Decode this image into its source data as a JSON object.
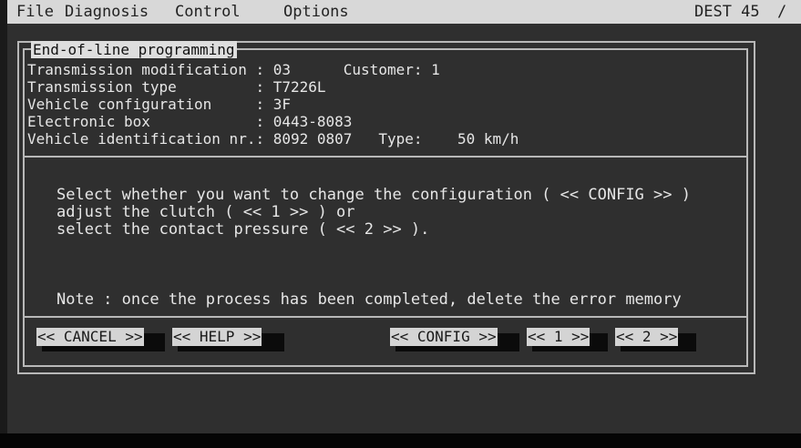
{
  "menu": {
    "file": "File",
    "diagnosis": "Diagnosis",
    "control": "Control",
    "options": "Options",
    "right_label": "DEST 45",
    "slash": "/"
  },
  "dialog": {
    "title": "End-of-line programming",
    "rows": [
      "Transmission modification : 03      Customer: 1",
      "Transmission type         : T7226L",
      "Vehicle configuration     : 3F",
      "Electronic box            : 0443-8083",
      "Vehicle identification nr.: 8092 0807   Type:    50 km/h"
    ],
    "message": [
      "Select whether you want to change the configuration ( << CONFIG >> )",
      "adjust the clutch ( << 1 >> ) or",
      "select the contact pressure ( << 2 >> )."
    ],
    "note": "Note : once the process has been completed, delete the error memory"
  },
  "buttons": {
    "cancel": "<< CANCEL >>",
    "help": "<< HELP >>",
    "config": "<< CONFIG >>",
    "one": "<< 1 >>",
    "two": "<< 2 >>"
  }
}
